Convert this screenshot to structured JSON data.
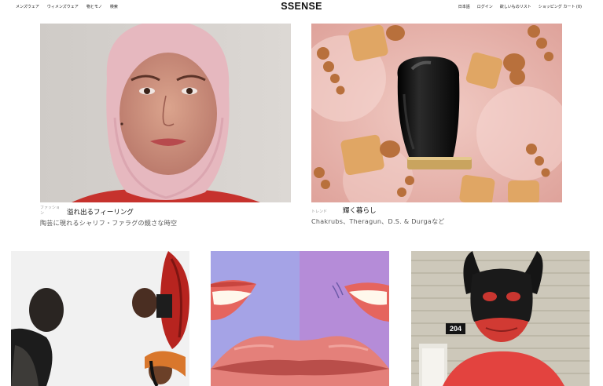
{
  "header": {
    "logo": "SSENSE",
    "nav_left": [
      "メンズウェア",
      "ウィメンズウェア",
      "物とモノ",
      "検索"
    ],
    "nav_right": [
      "日本語",
      "ログイン",
      "欲しいものリスト",
      "ショッピング カート (0)"
    ]
  },
  "features": [
    {
      "category": "ファッション",
      "title": "溢れ出るフィーリング",
      "subtitle": "陶芸に現れるシャリフ・ファラグの鏡さな時空"
    },
    {
      "category": "トレンド",
      "title": "輝く暮らし",
      "subtitle": "Chakrubs、Theragun、D.S. & Durgaなど"
    }
  ],
  "tiles": {
    "house_number": "204"
  },
  "colors": {
    "background": "#ffffff",
    "text": "#111111",
    "muted": "#999999"
  }
}
